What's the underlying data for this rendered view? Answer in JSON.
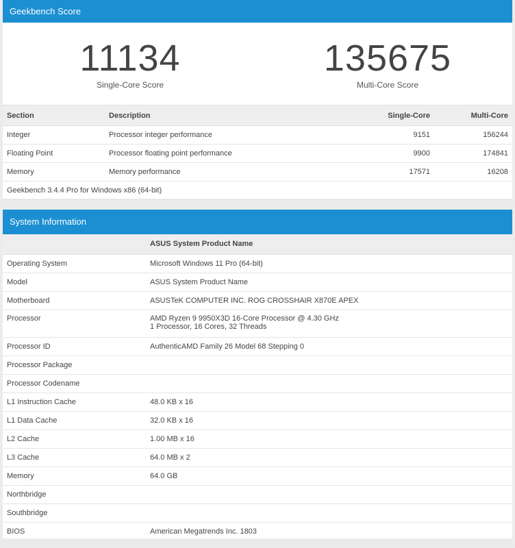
{
  "score_panel": {
    "title": "Geekbench Score",
    "single_core": {
      "value": "11134",
      "label": "Single-Core Score"
    },
    "multi_core": {
      "value": "135675",
      "label": "Multi-Core Score"
    },
    "table": {
      "headers": [
        "Section",
        "Description",
        "Single-Core",
        "Multi-Core"
      ],
      "rows": [
        {
          "section": "Integer",
          "description": "Processor integer performance",
          "single": "9151",
          "multi": "156244"
        },
        {
          "section": "Floating Point",
          "description": "Processor floating point performance",
          "single": "9900",
          "multi": "174841"
        },
        {
          "section": "Memory",
          "description": "Memory performance",
          "single": "17571",
          "multi": "16208"
        }
      ],
      "version": "Geekbench 3.4.4 Pro for Windows x86 (64-bit)"
    }
  },
  "system_panel": {
    "title": "System Information",
    "header_value": "ASUS System Product Name",
    "rows": [
      {
        "label": "Operating System",
        "value": "Microsoft Windows 11 Pro (64-bit)"
      },
      {
        "label": "Model",
        "value": "ASUS System Product Name"
      },
      {
        "label": "Motherboard",
        "value": "ASUSTeK COMPUTER INC. ROG CROSSHAIR X870E APEX"
      },
      {
        "label": "Processor",
        "value": "AMD Ryzen 9 9950X3D 16-Core Processor @ 4.30 GHz",
        "value2": "1 Processor, 16 Cores, 32 Threads"
      },
      {
        "label": "Processor ID",
        "value": "AuthenticAMD Family 26 Model 68 Stepping 0"
      },
      {
        "label": "Processor Package",
        "value": ""
      },
      {
        "label": "Processor Codename",
        "value": ""
      },
      {
        "label": "L1 Instruction Cache",
        "value": "48.0 KB x 16"
      },
      {
        "label": "L1 Data Cache",
        "value": "32.0 KB x 16"
      },
      {
        "label": "L2 Cache",
        "value": "1.00 MB x 16"
      },
      {
        "label": "L3 Cache",
        "value": "64.0 MB x 2"
      },
      {
        "label": "Memory",
        "value": "64.0 GB"
      },
      {
        "label": "Northbridge",
        "value": ""
      },
      {
        "label": "Southbridge",
        "value": ""
      },
      {
        "label": "BIOS",
        "value": "American Megatrends Inc. 1803"
      }
    ]
  },
  "colors": {
    "header_bg": "#1b8fd2",
    "table_header_bg": "#eeeeee",
    "page_bg": "#ececec"
  }
}
